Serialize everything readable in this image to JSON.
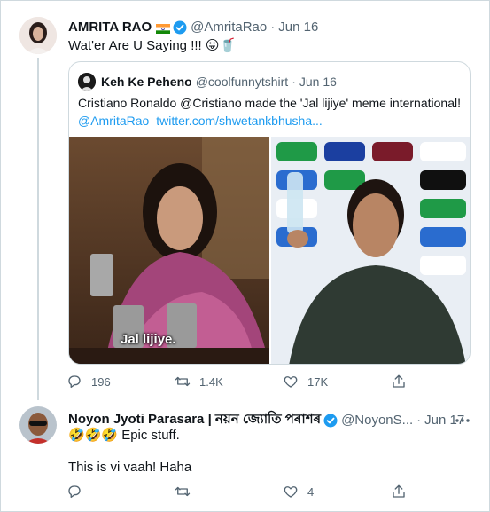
{
  "tweet1": {
    "name": "AMRITA RAO",
    "handle": "@AmritaRao",
    "separator": "·",
    "date": "Jun 16",
    "text": "Wat'er Are U Saying !!! 😛🥤",
    "quote": {
      "name": "Keh Ke Peheno",
      "handle": "@coolfunnytshirt",
      "separator": "·",
      "date": "Jun 16",
      "text_line1": "Cristiano Ronaldo @Cristiano made the 'Jal lijiye' meme international!",
      "mention": "@AmritaRao",
      "link": "twitter.com/shwetankbhusha...",
      "image_caption": "Jal lijiye."
    },
    "replies": "196",
    "retweets": "1.4K",
    "likes": "17K"
  },
  "tweet2": {
    "name": "Noyon Jyoti Parasara | নয়ন জ্যোতি পৰাশৰ",
    "handle": "@NoyonS...",
    "separator": "·",
    "date": "Jun 17",
    "line1": "🤣🤣🤣 Epic stuff.",
    "line2": "This is vi vaah! Haha",
    "replies": "",
    "retweets": "",
    "likes": "4"
  },
  "colors": {
    "accent": "#1d9bf0",
    "secondary_text": "#536471",
    "border": "#cfd9de"
  },
  "icons": [
    "verified-badge-icon",
    "india-flag-icon",
    "reply-icon",
    "retweet-icon",
    "like-icon",
    "share-icon",
    "more-icon"
  ]
}
